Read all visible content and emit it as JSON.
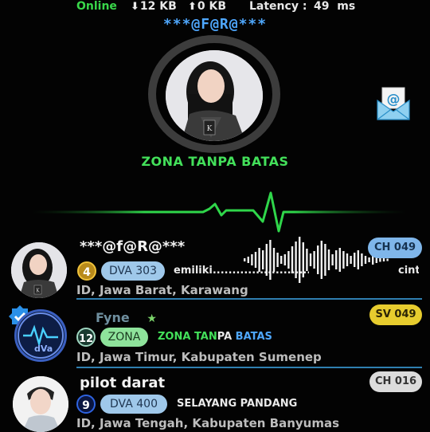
{
  "status": {
    "online": "Online",
    "download": "12 KB",
    "upload": "0 KB",
    "latency_label": "Latency :",
    "latency_value": "49  ms"
  },
  "brand": "***@F@R@***",
  "room_title": "ZONA TANPA BATAS",
  "icons": {
    "mail": "email-envelope-icon",
    "download": "arrow-down-icon",
    "upload": "arrow-up-icon",
    "verified": "verified-badge-icon",
    "pulse": "heartbeat-line-icon"
  },
  "colors": {
    "online": "#39d84a",
    "brand": "#4fa8ff",
    "room_title": "#43e05a",
    "pill_blue": "#9fc8ea",
    "pill_green": "#8ee39b",
    "ch_blue": "#7fb6ea",
    "sv_yellow": "#e7cc2e",
    "ch_gray": "#dcdcdc"
  },
  "users": [
    {
      "name": "***@f@R@***",
      "level": "4",
      "tag": "DVA 303",
      "message": "emiliki........................................",
      "message_tail": "cinta",
      "location": "ID, Jawa Barat, Karawang",
      "channel": "CH 049"
    },
    {
      "name": "Fyne",
      "level": "12",
      "tag": "ZONA",
      "message_part1": "ZONA TAN",
      "message_part2": "PA",
      "message_part3": " BATAS",
      "location": "ID, Jawa Timur, Kabupaten Sumenep",
      "channel": "SV 049"
    },
    {
      "name": "pilot darat",
      "level": "9",
      "tag": "DVA 400",
      "message": "SELAYANG PANDANG",
      "location": "ID, Jawa Tengah, Kabupaten Banyumas",
      "channel": "CH 016"
    }
  ]
}
